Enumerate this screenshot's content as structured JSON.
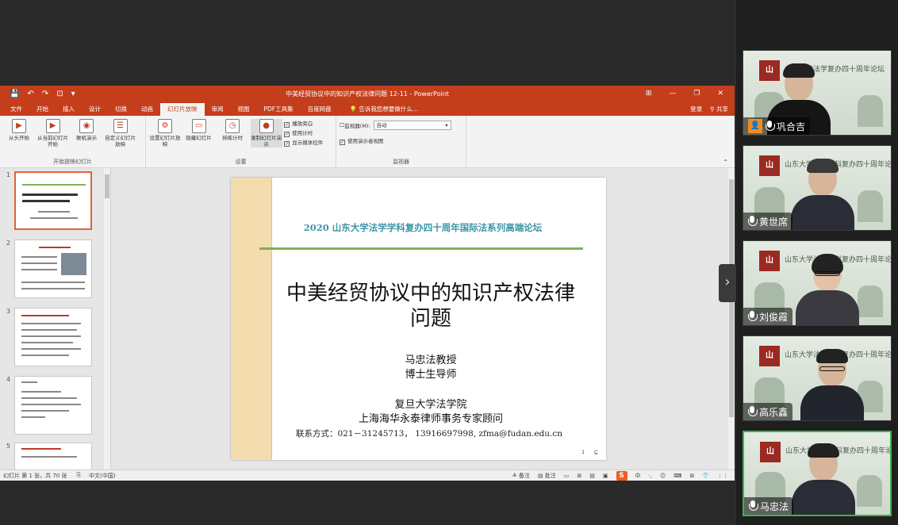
{
  "ppt": {
    "quick_access": [
      "💾",
      "↶",
      "↷",
      "⊡",
      "▾"
    ],
    "window_title": "中美经贸协议中的知识产权法律问题 12-11 - PowerPoint",
    "window_buttons": [
      "⊞",
      "—",
      "❐",
      "✕"
    ],
    "tabs": [
      {
        "label": "文件"
      },
      {
        "label": "开始"
      },
      {
        "label": "插入"
      },
      {
        "label": "设计"
      },
      {
        "label": "切换"
      },
      {
        "label": "动画"
      },
      {
        "label": "幻灯片放映"
      },
      {
        "label": "审阅"
      },
      {
        "label": "视图"
      },
      {
        "label": "PDF工具集"
      },
      {
        "label": "百度网盘"
      }
    ],
    "active_tab_index": 6,
    "tell_me": "告诉我您想要做什么...",
    "login": "登录",
    "share": "共享",
    "ribbon": {
      "group1_buttons": [
        {
          "icon": "▶",
          "label": "从头开始"
        },
        {
          "icon": "▶",
          "label": "从当前幻灯片开始"
        },
        {
          "icon": "◉",
          "label": "联机演示"
        },
        {
          "icon": "☰",
          "label": "自定义幻灯片放映"
        }
      ],
      "group1_label": "开始放映幻灯片",
      "group2_buttons": [
        {
          "icon": "⚙",
          "label": "设置幻灯片放映"
        },
        {
          "icon": "▭",
          "label": "隐藏幻灯片"
        },
        {
          "icon": "◷",
          "label": "排练计时"
        },
        {
          "icon": "●",
          "label": "录制幻灯片演示"
        }
      ],
      "group2_checks": [
        {
          "label": "播放旁白",
          "checked": true
        },
        {
          "label": "使用计时",
          "checked": true
        },
        {
          "label": "显示媒体控件",
          "checked": true
        }
      ],
      "group2_label": "设置",
      "monitor_label": "监视器(M):",
      "monitor_value": "自动",
      "presenter_view": "使用演示者视图",
      "group3_label": "监视器"
    },
    "thumb_numbers": [
      "1",
      "2",
      "3",
      "4",
      "5"
    ],
    "slide": {
      "forum": "2020 山东大学法学学科复办四十周年国际法系列高端论坛",
      "title_line1": "中美经贸协议中的知识产权法律",
      "title_line2": "问题",
      "presenter": "马忠法教授",
      "presenter_role": "博士生导师",
      "institution": "复旦大学法学院",
      "consultant": "上海海华永泰律师事务专家顾问",
      "contact": "联系方式：021－31245713， 13916697998, zfma@fudan.edu.cn",
      "page_number": "1　　⊑"
    },
    "status": {
      "slide_count": "幻灯片 第 1 张，共 70 张",
      "language": "中文(中国)",
      "notes": "≜ 备注",
      "comments": "▤ 批注",
      "ime_items": [
        "中",
        "·,",
        "☺",
        "⌨",
        "⊞",
        "👕",
        "⋮⋮"
      ]
    }
  },
  "participants": [
    {
      "name": "巩合吉",
      "bg_text": "山东大学法学复办四十周年论坛",
      "badge": "👤"
    },
    {
      "name": "黄世席",
      "bg_text": "山东大学法学学科复办四十周年论坛",
      "badge": ""
    },
    {
      "name": "刘俊霞",
      "bg_text": "山东大学法学学科复办四十周年论坛",
      "badge": ""
    },
    {
      "name": "高乐鑫",
      "bg_text": "山东大学法学学科复办四十周年论坛",
      "badge": ""
    },
    {
      "name": "马忠法",
      "bg_text": "山东大学法学学科复办四十周年论坛",
      "badge": ""
    }
  ],
  "colors": {
    "ppt_accent": "#c43e1c",
    "active_speaker": "#3ab54a"
  },
  "icons": {
    "next": "›",
    "sogou": "S"
  }
}
